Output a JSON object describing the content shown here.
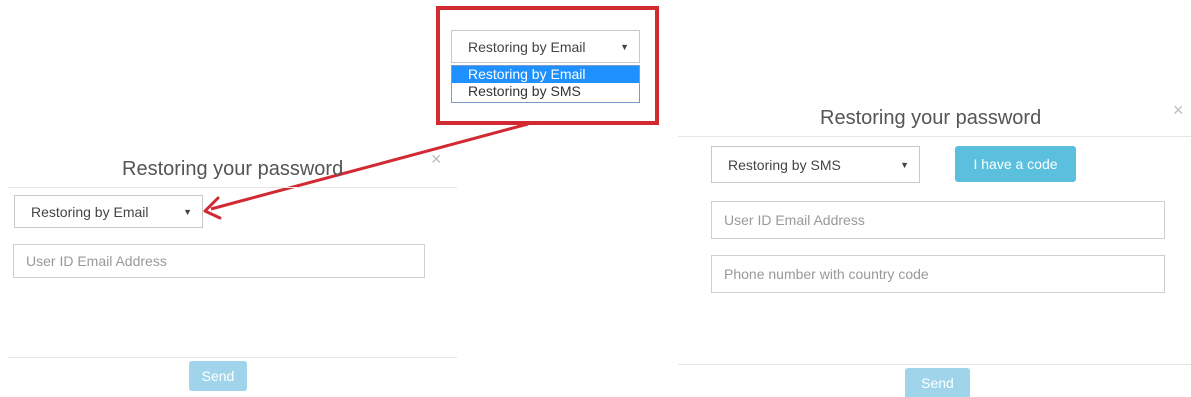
{
  "callout": {
    "selected_label": "Restoring by Email",
    "options": [
      {
        "label": "Restoring by Email"
      },
      {
        "label": "Restoring by SMS"
      }
    ]
  },
  "left_dialog": {
    "title": "Restoring your password",
    "close": "×",
    "method_select": "Restoring by Email",
    "email_placeholder": "User ID Email Address",
    "send_label": "Send"
  },
  "right_dialog": {
    "title": "Restoring your password",
    "close": "×",
    "method_select": "Restoring by SMS",
    "code_button": "I have a code",
    "email_placeholder": "User ID Email Address",
    "phone_placeholder": "Phone number with country code",
    "send_label": "Send"
  },
  "colors": {
    "callout_border": "#d22a32",
    "option_highlight": "#1e90ff",
    "code_button": "#5bc0de",
    "send_button": "#9fd4ea"
  },
  "icons": {
    "caret": "caret-down-icon",
    "close": "close-icon",
    "arrow": "arrow-annotation"
  }
}
